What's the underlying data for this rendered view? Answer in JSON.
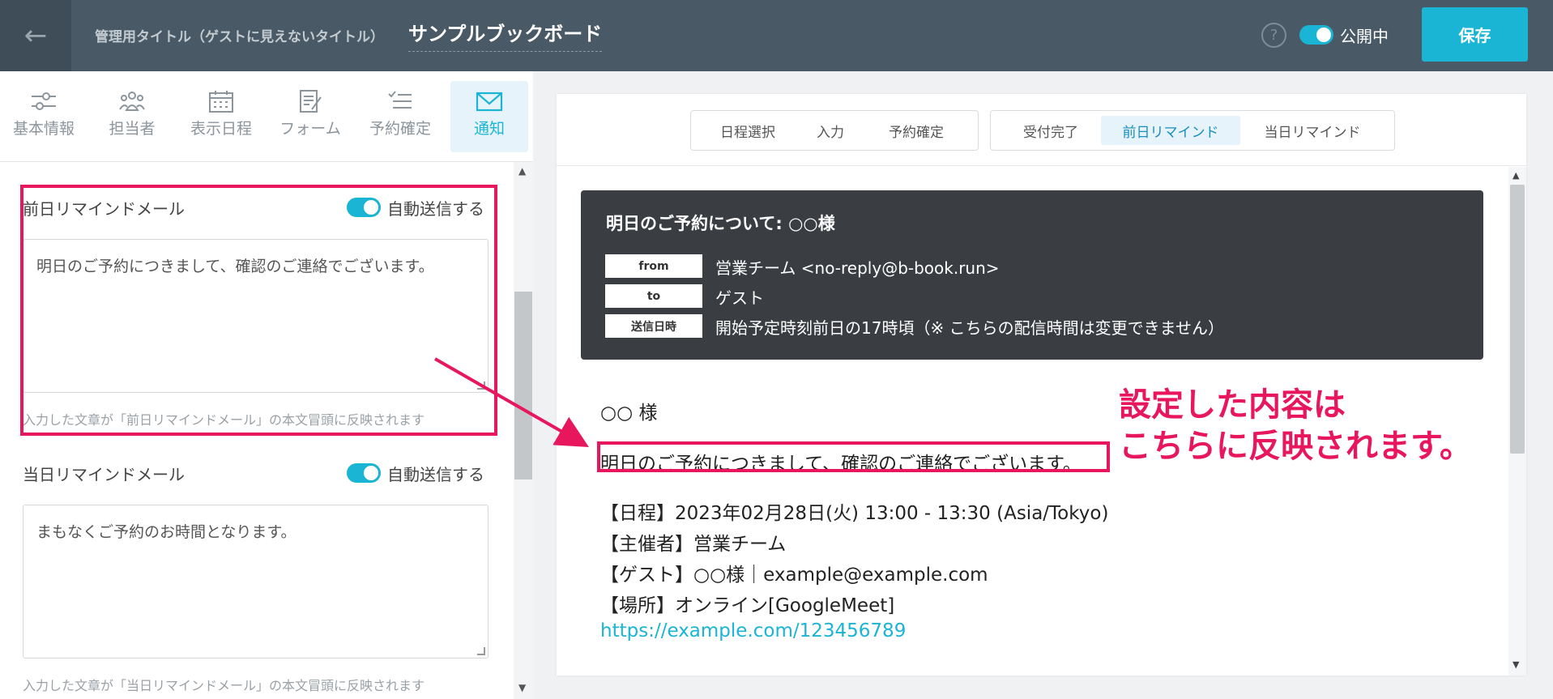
{
  "header": {
    "back_icon": "←",
    "admin_title_label": "管理用タイトル（ゲストに見えないタイトル）",
    "book_title": "サンプルブックボード",
    "help_icon": "?",
    "publish_label": "公開中",
    "publish_on": true,
    "save_label": "保存"
  },
  "left_tabs": [
    {
      "label": "基本情報",
      "icon": "sliders-icon"
    },
    {
      "label": "担当者",
      "icon": "users-icon"
    },
    {
      "label": "表示日程",
      "icon": "calendar-icon"
    },
    {
      "label": "フォーム",
      "icon": "form-icon"
    },
    {
      "label": "予約確定",
      "icon": "checklist-icon"
    },
    {
      "label": "通知",
      "icon": "mail-icon",
      "active": true
    }
  ],
  "reminders": {
    "prev_day": {
      "title": "前日リマインドメール",
      "toggle_label": "自動送信する",
      "enabled": true,
      "text": "明日のご予約につきまして、確認のご連絡でございます。",
      "helper": "入力した文章が「前日リマインドメール」の本文冒頭に反映されます"
    },
    "same_day": {
      "title": "当日リマインドメール",
      "toggle_label": "自動送信する",
      "enabled": true,
      "text": "まもなくご予約のお時間となります。",
      "helper": "入力した文章が「当日リマインドメール」の本文冒頭に反映されます"
    }
  },
  "preview_tabs": {
    "group1": [
      "日程選択",
      "入力",
      "予約確定"
    ],
    "group2": [
      "受付完了",
      "前日リマインド",
      "当日リマインド"
    ],
    "active": "前日リマインド"
  },
  "mail": {
    "subject": "明日のご予約について: ○○様",
    "from_tag": "from",
    "from_value": "営業チーム <no-reply@b-book.run>",
    "to_tag": "to",
    "to_value": "ゲスト",
    "sent_tag": "送信日時",
    "sent_value": "開始予定時刻前日の17時頃（※ こちらの配信時間は変更できません）",
    "greeting": "○○ 様",
    "intro": "明日のご予約につきまして、確認のご連絡でございます。",
    "schedule": "【日程】2023年02月28日(火) 13:00 - 13:30 (Asia/Tokyo)",
    "organizer": "【主催者】営業チーム",
    "guest": "【ゲスト】○○様｜example@example.com",
    "place": "【場所】オンライン[GoogleMeet]",
    "link": "https://example.com/123456789"
  },
  "annotation": {
    "line1": "設定した内容は",
    "line2": "こちらに反映されます。",
    "color": "#e8175d"
  },
  "colors": {
    "accent": "#1ab5d4",
    "header_bg": "#495a66",
    "mail_header_bg": "#3a3e43"
  }
}
